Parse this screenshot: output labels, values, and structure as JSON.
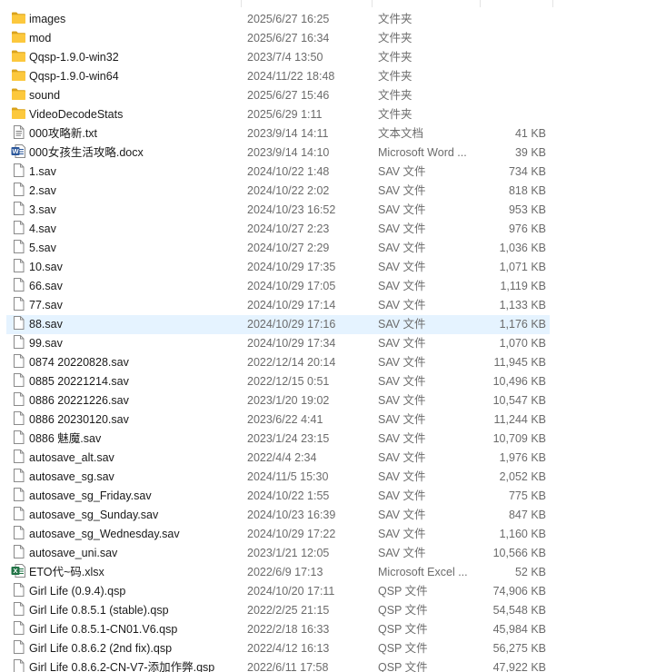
{
  "files": [
    {
      "name": "images",
      "date": "2025/6/27 16:25",
      "type": "文件夹",
      "size": "",
      "icon": "folder-icon"
    },
    {
      "name": "mod",
      "date": "2025/6/27 16:34",
      "type": "文件夹",
      "size": "",
      "icon": "folder-icon"
    },
    {
      "name": "Qqsp-1.9.0-win32",
      "date": "2023/7/4 13:50",
      "type": "文件夹",
      "size": "",
      "icon": "folder-icon"
    },
    {
      "name": "Qqsp-1.9.0-win64",
      "date": "2024/11/22 18:48",
      "type": "文件夹",
      "size": "",
      "icon": "folder-icon"
    },
    {
      "name": "sound",
      "date": "2025/6/27 15:46",
      "type": "文件夹",
      "size": "",
      "icon": "folder-icon"
    },
    {
      "name": "VideoDecodeStats",
      "date": "2025/6/29 1:11",
      "type": "文件夹",
      "size": "",
      "icon": "folder-icon"
    },
    {
      "name": "000攻略新.txt",
      "date": "2023/9/14 14:11",
      "type": "文本文档",
      "size": "41 KB",
      "icon": "text-file-icon"
    },
    {
      "name": "000女孩生活攻略.docx",
      "date": "2023/9/14 14:10",
      "type": "Microsoft Word ...",
      "size": "39 KB",
      "icon": "word-file-icon"
    },
    {
      "name": "1.sav",
      "date": "2024/10/22 1:48",
      "type": "SAV 文件",
      "size": "734 KB",
      "icon": "file-icon"
    },
    {
      "name": "2.sav",
      "date": "2024/10/22 2:02",
      "type": "SAV 文件",
      "size": "818 KB",
      "icon": "file-icon"
    },
    {
      "name": "3.sav",
      "date": "2024/10/23 16:52",
      "type": "SAV 文件",
      "size": "953 KB",
      "icon": "file-icon"
    },
    {
      "name": "4.sav",
      "date": "2024/10/27 2:23",
      "type": "SAV 文件",
      "size": "976 KB",
      "icon": "file-icon"
    },
    {
      "name": "5.sav",
      "date": "2024/10/27 2:29",
      "type": "SAV 文件",
      "size": "1,036 KB",
      "icon": "file-icon"
    },
    {
      "name": "10.sav",
      "date": "2024/10/29 17:35",
      "type": "SAV 文件",
      "size": "1,071 KB",
      "icon": "file-icon"
    },
    {
      "name": "66.sav",
      "date": "2024/10/29 17:05",
      "type": "SAV 文件",
      "size": "1,119 KB",
      "icon": "file-icon"
    },
    {
      "name": "77.sav",
      "date": "2024/10/29 17:14",
      "type": "SAV 文件",
      "size": "1,133 KB",
      "icon": "file-icon"
    },
    {
      "name": "88.sav",
      "date": "2024/10/29 17:16",
      "type": "SAV 文件",
      "size": "1,176 KB",
      "icon": "file-icon",
      "selected": true
    },
    {
      "name": "99.sav",
      "date": "2024/10/29 17:34",
      "type": "SAV 文件",
      "size": "1,070 KB",
      "icon": "file-icon"
    },
    {
      "name": "0874 20220828.sav",
      "date": "2022/12/14 20:14",
      "type": "SAV 文件",
      "size": "11,945 KB",
      "icon": "file-icon"
    },
    {
      "name": "0885 20221214.sav",
      "date": "2022/12/15 0:51",
      "type": "SAV 文件",
      "size": "10,496 KB",
      "icon": "file-icon"
    },
    {
      "name": "0886 20221226.sav",
      "date": "2023/1/20 19:02",
      "type": "SAV 文件",
      "size": "10,547 KB",
      "icon": "file-icon"
    },
    {
      "name": "0886 20230120.sav",
      "date": "2023/6/22 4:41",
      "type": "SAV 文件",
      "size": "11,244 KB",
      "icon": "file-icon"
    },
    {
      "name": "0886 魅魔.sav",
      "date": "2023/1/24 23:15",
      "type": "SAV 文件",
      "size": "10,709 KB",
      "icon": "file-icon"
    },
    {
      "name": "autosave_alt.sav",
      "date": "2022/4/4 2:34",
      "type": "SAV 文件",
      "size": "1,976 KB",
      "icon": "file-icon"
    },
    {
      "name": "autosave_sg.sav",
      "date": "2024/11/5 15:30",
      "type": "SAV 文件",
      "size": "2,052 KB",
      "icon": "file-icon"
    },
    {
      "name": "autosave_sg_Friday.sav",
      "date": "2024/10/22 1:55",
      "type": "SAV 文件",
      "size": "775 KB",
      "icon": "file-icon"
    },
    {
      "name": "autosave_sg_Sunday.sav",
      "date": "2024/10/23 16:39",
      "type": "SAV 文件",
      "size": "847 KB",
      "icon": "file-icon"
    },
    {
      "name": "autosave_sg_Wednesday.sav",
      "date": "2024/10/29 17:22",
      "type": "SAV 文件",
      "size": "1,160 KB",
      "icon": "file-icon"
    },
    {
      "name": "autosave_uni.sav",
      "date": "2023/1/21 12:05",
      "type": "SAV 文件",
      "size": "10,566 KB",
      "icon": "file-icon"
    },
    {
      "name": "ETO代~码.xlsx",
      "date": "2022/6/9 17:13",
      "type": "Microsoft Excel ...",
      "size": "52 KB",
      "icon": "excel-file-icon"
    },
    {
      "name": "Girl Life (0.9.4).qsp",
      "date": "2024/10/20 17:11",
      "type": "QSP 文件",
      "size": "74,906 KB",
      "icon": "file-icon"
    },
    {
      "name": "Girl Life 0.8.5.1 (stable).qsp",
      "date": "2022/2/25 21:15",
      "type": "QSP 文件",
      "size": "54,548 KB",
      "icon": "file-icon"
    },
    {
      "name": "Girl Life 0.8.5.1-CN01.V6.qsp",
      "date": "2022/2/18 16:33",
      "type": "QSP 文件",
      "size": "45,984 KB",
      "icon": "file-icon"
    },
    {
      "name": "Girl Life 0.8.6.2 (2nd fix).qsp",
      "date": "2022/4/12 16:13",
      "type": "QSP 文件",
      "size": "56,275 KB",
      "icon": "file-icon"
    },
    {
      "name": "Girl Life 0.8.6.2-CN-V7-添加作弊.qsp",
      "date": "2022/6/11 17:58",
      "type": "QSP 文件",
      "size": "47,922 KB",
      "icon": "file-icon"
    }
  ]
}
